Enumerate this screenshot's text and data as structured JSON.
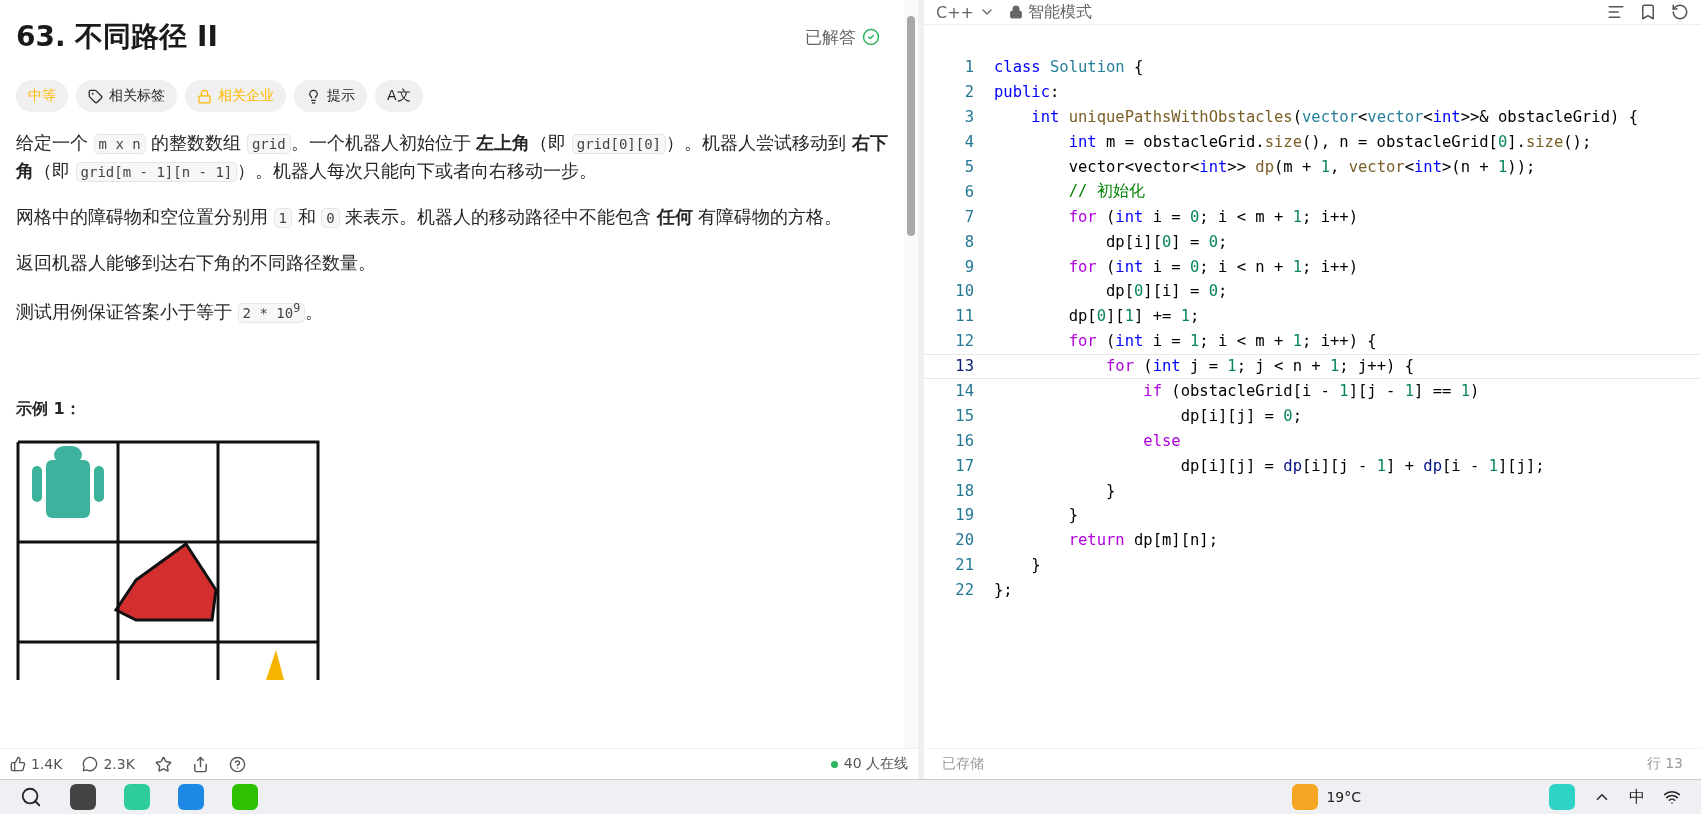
{
  "problem": {
    "title": "63. 不同路径 II",
    "status": "已解答",
    "tags": [
      {
        "kind": "difficulty",
        "label": "中等"
      },
      {
        "kind": "tag",
        "label": "相关标签"
      },
      {
        "kind": "locked",
        "label": "相关企业"
      },
      {
        "kind": "hint",
        "label": "提示"
      },
      {
        "kind": "translate",
        "label": "A文"
      }
    ],
    "paragraphs": [
      [
        {
          "kind": "text",
          "text": "给定一个 "
        },
        {
          "kind": "code",
          "text": "m x n"
        },
        {
          "kind": "text",
          "text": " 的整数数组 "
        },
        {
          "kind": "code",
          "text": "grid"
        },
        {
          "kind": "text",
          "text": "。一个机器人初始位于 "
        },
        {
          "kind": "bold",
          "text": "左上角"
        },
        {
          "kind": "text",
          "text": "（即 "
        },
        {
          "kind": "code",
          "text": "grid[0][0]"
        },
        {
          "kind": "text",
          "text": "）。机器人尝试移动到 "
        },
        {
          "kind": "bold",
          "text": "右下角"
        },
        {
          "kind": "text",
          "text": "（即 "
        },
        {
          "kind": "code",
          "text": "grid[m - 1][n - 1]"
        },
        {
          "kind": "text",
          "text": "）。机器人每次只能向下或者向右移动一步。"
        }
      ],
      [
        {
          "kind": "text",
          "text": "网格中的障碍物和空位置分别用 "
        },
        {
          "kind": "code",
          "text": "1"
        },
        {
          "kind": "text",
          "text": " 和 "
        },
        {
          "kind": "code",
          "text": "0"
        },
        {
          "kind": "text",
          "text": " 来表示。机器人的移动路径中不能包含 "
        },
        {
          "kind": "bold",
          "text": "任何"
        },
        {
          "kind": "text",
          "text": " 有障碍物的方格。"
        }
      ],
      [
        {
          "kind": "text",
          "text": "返回机器人能够到达右下角的不同路径数量。"
        }
      ],
      [
        {
          "kind": "text",
          "text": "测试用例保证答案小于等于 "
        },
        {
          "kind": "code",
          "text": "2 * 10$^{9}$"
        },
        {
          "kind": "text",
          "text": "。"
        }
      ]
    ],
    "example_heading": "示例 1：",
    "footer": {
      "likes": "1.4K",
      "comments": "2.3K",
      "online": "40 人在线"
    }
  },
  "editor": {
    "language": "C++",
    "mode": "智能模式",
    "status": "已存储",
    "cursor": "行 13",
    "lines": [
      {
        "number": "1",
        "selected": false,
        "tokens": [
          {
            "kind": "keyword",
            "text": "class "
          },
          {
            "kind": "type",
            "text": "Solution"
          },
          {
            "kind": "plain",
            "text": " {"
          }
        ]
      },
      {
        "number": "2",
        "selected": false,
        "tokens": [
          {
            "kind": "keyword",
            "text": "public"
          },
          {
            "kind": "plain",
            "text": ":"
          }
        ]
      },
      {
        "number": "3",
        "selected": false,
        "tokens": [
          {
            "kind": "keyword",
            "text": "    int "
          },
          {
            "kind": "function",
            "text": "uniquePathsWithObstacles"
          },
          {
            "kind": "plain",
            "text": "("
          },
          {
            "kind": "type",
            "text": "vector"
          },
          {
            "kind": "plain",
            "text": "<"
          },
          {
            "kind": "type",
            "text": "vector"
          },
          {
            "kind": "plain",
            "text": "<"
          },
          {
            "kind": "keyword",
            "text": "int"
          },
          {
            "kind": "plain",
            "text": ">>& obstacleGrid) {"
          }
        ]
      },
      {
        "number": "4",
        "selected": false,
        "tokens": [
          {
            "kind": "keyword",
            "text": "        int"
          },
          {
            "kind": "plain",
            "text": " m = obstacleGrid."
          },
          {
            "kind": "function",
            "text": "size"
          },
          {
            "kind": "plain",
            "text": "(), n = obstacleGrid["
          },
          {
            "kind": "number",
            "text": "0"
          },
          {
            "kind": "plain",
            "text": "]."
          },
          {
            "kind": "function",
            "text": "size"
          },
          {
            "kind": "plain",
            "text": "();"
          }
        ]
      },
      {
        "number": "5",
        "selected": false,
        "tokens": [
          {
            "kind": "plain",
            "text": "        vector<vector<"
          },
          {
            "kind": "keyword",
            "text": "int"
          },
          {
            "kind": "plain",
            "text": ">> "
          },
          {
            "kind": "function",
            "text": "dp"
          },
          {
            "kind": "plain",
            "text": "(m + "
          },
          {
            "kind": "number",
            "text": "1"
          },
          {
            "kind": "plain",
            "text": ", "
          },
          {
            "kind": "function",
            "text": "vector"
          },
          {
            "kind": "plain",
            "text": "<"
          },
          {
            "kind": "keyword",
            "text": "int"
          },
          {
            "kind": "plain",
            "text": ">(n + "
          },
          {
            "kind": "number",
            "text": "1"
          },
          {
            "kind": "plain",
            "text": "));"
          }
        ]
      },
      {
        "number": "6",
        "selected": false,
        "tokens": [
          {
            "kind": "comment",
            "text": "        // 初始化"
          }
        ]
      },
      {
        "number": "7",
        "selected": false,
        "tokens": [
          {
            "kind": "control",
            "text": "        for"
          },
          {
            "kind": "plain",
            "text": " ("
          },
          {
            "kind": "keyword",
            "text": "int"
          },
          {
            "kind": "plain",
            "text": " i = "
          },
          {
            "kind": "number",
            "text": "0"
          },
          {
            "kind": "plain",
            "text": "; i < m + "
          },
          {
            "kind": "number",
            "text": "1"
          },
          {
            "kind": "plain",
            "text": "; i++)"
          }
        ]
      },
      {
        "number": "8",
        "selected": false,
        "tokens": [
          {
            "kind": "plain",
            "text": "            dp[i]["
          },
          {
            "kind": "number",
            "text": "0"
          },
          {
            "kind": "plain",
            "text": "] = "
          },
          {
            "kind": "number",
            "text": "0"
          },
          {
            "kind": "plain",
            "text": ";"
          }
        ]
      },
      {
        "number": "9",
        "selected": false,
        "tokens": [
          {
            "kind": "control",
            "text": "        for"
          },
          {
            "kind": "plain",
            "text": " ("
          },
          {
            "kind": "keyword",
            "text": "int"
          },
          {
            "kind": "plain",
            "text": " i = "
          },
          {
            "kind": "number",
            "text": "0"
          },
          {
            "kind": "plain",
            "text": "; i < n + "
          },
          {
            "kind": "number",
            "text": "1"
          },
          {
            "kind": "plain",
            "text": "; i++)"
          }
        ]
      },
      {
        "number": "10",
        "selected": false,
        "tokens": [
          {
            "kind": "plain",
            "text": "            dp["
          },
          {
            "kind": "number",
            "text": "0"
          },
          {
            "kind": "plain",
            "text": "][i] = "
          },
          {
            "kind": "number",
            "text": "0"
          },
          {
            "kind": "plain",
            "text": ";"
          }
        ]
      },
      {
        "number": "11",
        "selected": false,
        "tokens": [
          {
            "kind": "plain",
            "text": "        dp["
          },
          {
            "kind": "number",
            "text": "0"
          },
          {
            "kind": "plain",
            "text": "]["
          },
          {
            "kind": "number",
            "text": "1"
          },
          {
            "kind": "plain",
            "text": "] += "
          },
          {
            "kind": "number",
            "text": "1"
          },
          {
            "kind": "plain",
            "text": ";"
          }
        ]
      },
      {
        "number": "12",
        "selected": false,
        "tokens": [
          {
            "kind": "control",
            "text": "        for"
          },
          {
            "kind": "plain",
            "text": " ("
          },
          {
            "kind": "keyword",
            "text": "int"
          },
          {
            "kind": "plain",
            "text": " i = "
          },
          {
            "kind": "number",
            "text": "1"
          },
          {
            "kind": "plain",
            "text": "; i < m + "
          },
          {
            "kind": "number",
            "text": "1"
          },
          {
            "kind": "plain",
            "text": "; i++) {"
          }
        ]
      },
      {
        "number": "13",
        "selected": true,
        "tokens": [
          {
            "kind": "control",
            "text": "            for"
          },
          {
            "kind": "plain",
            "text": " ("
          },
          {
            "kind": "keyword",
            "text": "int"
          },
          {
            "kind": "plain",
            "text": " j = "
          },
          {
            "kind": "number",
            "text": "1"
          },
          {
            "kind": "plain",
            "text": "; j < n + "
          },
          {
            "kind": "number",
            "text": "1"
          },
          {
            "kind": "plain",
            "text": "; j++) {"
          }
        ]
      },
      {
        "number": "14",
        "selected": false,
        "tokens": [
          {
            "kind": "control",
            "text": "                if"
          },
          {
            "kind": "plain",
            "text": " (obstacleGrid[i - "
          },
          {
            "kind": "number",
            "text": "1"
          },
          {
            "kind": "plain",
            "text": "][j - "
          },
          {
            "kind": "number",
            "text": "1"
          },
          {
            "kind": "plain",
            "text": "] == "
          },
          {
            "kind": "number",
            "text": "1"
          },
          {
            "kind": "plain",
            "text": ")"
          }
        ]
      },
      {
        "number": "15",
        "selected": false,
        "tokens": [
          {
            "kind": "plain",
            "text": "                    dp[i][j] = "
          },
          {
            "kind": "number",
            "text": "0"
          },
          {
            "kind": "plain",
            "text": ";"
          }
        ]
      },
      {
        "number": "16",
        "selected": false,
        "tokens": [
          {
            "kind": "control",
            "text": "                else"
          }
        ]
      },
      {
        "number": "17",
        "selected": false,
        "tokens": [
          {
            "kind": "plain",
            "text": "                    dp[i][j] = "
          },
          {
            "kind": "variable",
            "text": "dp"
          },
          {
            "kind": "plain",
            "text": "[i][j - "
          },
          {
            "kind": "number",
            "text": "1"
          },
          {
            "kind": "plain",
            "text": "] + "
          },
          {
            "kind": "variable",
            "text": "dp"
          },
          {
            "kind": "plain",
            "text": "[i - "
          },
          {
            "kind": "number",
            "text": "1"
          },
          {
            "kind": "plain",
            "text": "][j];"
          }
        ]
      },
      {
        "number": "18",
        "selected": false,
        "tokens": [
          {
            "kind": "plain",
            "text": "            }"
          }
        ]
      },
      {
        "number": "19",
        "selected": false,
        "tokens": [
          {
            "kind": "plain",
            "text": "        }"
          }
        ]
      },
      {
        "number": "20",
        "selected": false,
        "tokens": [
          {
            "kind": "control",
            "text": "        return"
          },
          {
            "kind": "plain",
            "text": " dp[m][n];"
          }
        ]
      },
      {
        "number": "21",
        "selected": false,
        "tokens": [
          {
            "kind": "plain",
            "text": "    }"
          }
        ]
      },
      {
        "number": "22",
        "selected": false,
        "tokens": [
          {
            "kind": "plain",
            "text": "};"
          }
        ]
      }
    ]
  },
  "taskbar": {
    "temperature": "19°C",
    "input_method": "中"
  }
}
